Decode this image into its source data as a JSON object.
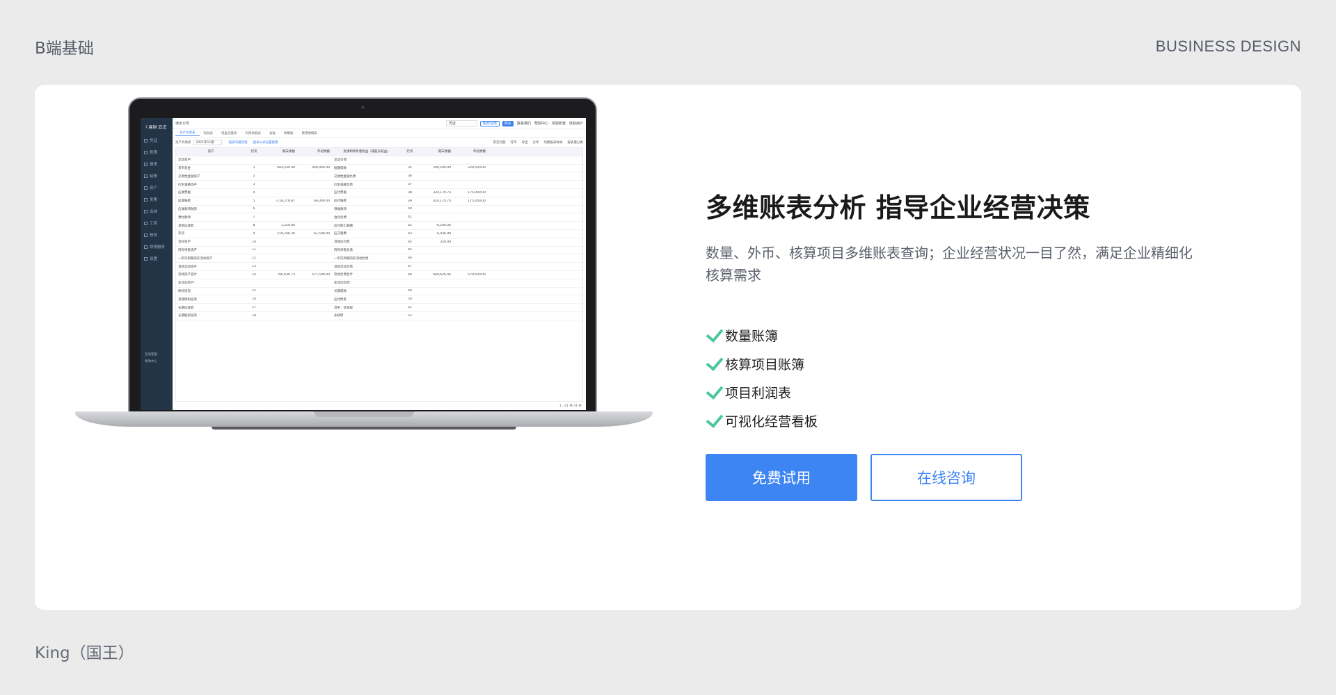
{
  "page": {
    "brand_left": "B端基础",
    "brand_right": "BUSINESS DESIGN",
    "footer_name": "King（国王）"
  },
  "hero": {
    "headline": "多维账表分析 指导企业经营决策",
    "description": "数量、外币、核算项目多维账表查询；企业经营状况一目了然，满足企业精细化核算需求",
    "features": [
      "数量账簿",
      "核算项目账簿",
      "项目利润表",
      "可视化经营看板"
    ],
    "primary_button": "免费试用",
    "secondary_button": "在线咨询",
    "accent_color": "#3d85f2",
    "check_color": "#4cc79a"
  },
  "screen": {
    "logo": "〈 易财 云记",
    "nav": [
      "凭证",
      "账簿",
      "报表",
      "结账",
      "资产",
      "发票",
      "出纳",
      "工资",
      "税务",
      "财税服务",
      "设置"
    ],
    "nav_bottom": [
      "在线客服",
      "帮助中心"
    ],
    "company": "演示公司",
    "top_search": "凭证",
    "top_buttons": [
      "免费试用",
      "购买"
    ],
    "top_links": [
      "联系我们",
      "帮助中心",
      "体验账套",
      "体验用户"
    ],
    "tabs": [
      "资产负债表",
      "利润表",
      "现金流量表",
      "科目余额表",
      "总账",
      "明细账",
      "费用明细表"
    ],
    "period_label": "资产负债表",
    "period_value": "2021年11期",
    "tool_links": [
      "报表勾稽流程",
      "报表公式设置指南"
    ],
    "tool_right": [
      "常见问题",
      "打印",
      "导出",
      "分享",
      "切换报表样式",
      "报表重分类"
    ],
    "headers": [
      "资产",
      "行次",
      "期末余额",
      "年初余额",
      "负债和所有者权益（或股东权益）",
      "行次",
      "期末余额",
      "年初余额"
    ],
    "rows": [
      [
        "流动资产:",
        "",
        "",
        "",
        "流动负债:",
        "",
        "",
        ""
      ],
      [
        "货币资金",
        "1",
        "604,549.40",
        "440,000.00",
        "短期借款",
        "35",
        "209,500.00",
        "229,500.00"
      ],
      [
        "交易性金融资产",
        "2",
        "",
        "",
        "交易性金融负债",
        "36",
        "",
        ""
      ],
      [
        "衍生金融资产",
        "3",
        "",
        "",
        "衍生金融负债",
        "37",
        "",
        ""
      ],
      [
        "应收票据",
        "4",
        "",
        "",
        "应付票据",
        "38",
        "324,170.73",
        "175,000.00"
      ],
      [
        "应收账款",
        "5",
        "-118,278.87",
        "66,000.00",
        "应付账款",
        "39",
        "324,170.73",
        "175,000.00"
      ],
      [
        "应收款项融资",
        "6",
        "",
        "",
        "预收款项",
        "40",
        "",
        ""
      ],
      [
        "预付款项",
        "7",
        "",
        "",
        "合同负债",
        "41",
        "",
        ""
      ],
      [
        "其他应收款",
        "8",
        "1,220.00",
        "",
        "应付职工薪酬",
        "42",
        "-6,200.00",
        ""
      ],
      [
        "存货",
        "9",
        "219,246.20",
        "61,500.00",
        "应交税费",
        "43",
        "6,436.00",
        ""
      ],
      [
        "合同资产",
        "10",
        "",
        "",
        "其他应付款",
        "44",
        "350.00",
        ""
      ],
      [
        "持有待售资产",
        "11",
        "",
        "",
        "持有待售负债",
        "45",
        "",
        ""
      ],
      [
        "一年内到期的非流动资产",
        "12",
        "",
        "",
        "一年内到期的非流动负债",
        "46",
        "",
        ""
      ],
      [
        "其他流动资产",
        "13",
        "",
        "",
        "其他流动负债",
        "47",
        "",
        ""
      ],
      [
        "流动资产合计",
        "14",
        "706,936.73",
        "577,500.00",
        "流动负债合计",
        "48",
        "660,626.46",
        "579,500.00"
      ],
      [
        "非流动资产:",
        "",
        "",
        "",
        "非流动负债:",
        "",
        "",
        ""
      ],
      [
        "债权投资",
        "15",
        "",
        "",
        "长期借款",
        "49",
        "",
        ""
      ],
      [
        "其他债权投资",
        "16",
        "",
        "",
        "应付债券",
        "50",
        "",
        ""
      ],
      [
        "长期应收款",
        "17",
        "",
        "",
        "其中：优先股",
        "51",
        "",
        ""
      ],
      [
        "长期股权投资",
        "18",
        "",
        "",
        "永续债",
        "52",
        "",
        ""
      ]
    ],
    "pager": "1 - 41   共 41 条"
  }
}
